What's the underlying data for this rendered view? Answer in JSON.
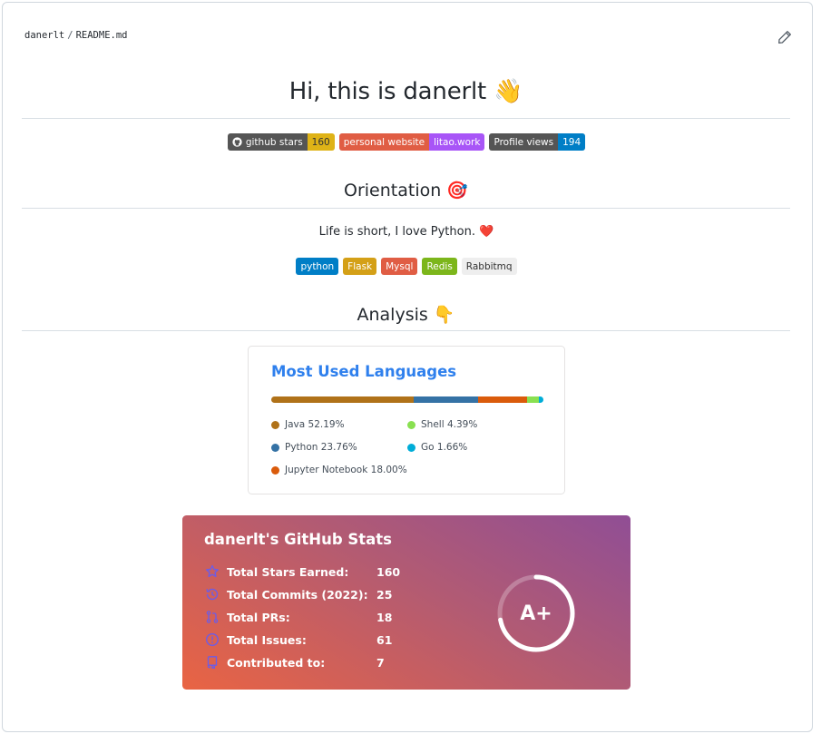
{
  "breadcrumb": {
    "owner": "danerlt",
    "separator": "/",
    "file": "README.md"
  },
  "heading": {
    "text": "Hi, this is danerlt",
    "emoji": "👋"
  },
  "badges": [
    {
      "label": "github stars",
      "value": "160",
      "value_color": "#dfb317"
    },
    {
      "label": "personal website",
      "value": "litao.work",
      "label_color": "#e05d44",
      "value_color": "#a855f7"
    },
    {
      "label": "Profile views",
      "value": "194",
      "value_color": "#007ec6"
    }
  ],
  "orientation": {
    "title": "Orientation",
    "emoji": "🎯",
    "motto": "Life is short, I love Python.",
    "motto_emoji": "❤️",
    "tags": [
      {
        "text": "python",
        "color": "#007ec6",
        "text_color": "#ffffff"
      },
      {
        "text": "Flask",
        "color": "#d4a017",
        "text_color": "#ffffff"
      },
      {
        "text": "Mysql",
        "color": "#e05d44",
        "text_color": "#ffffff"
      },
      {
        "text": "Redis",
        "color": "#7cb61b",
        "text_color": "#ffffff"
      },
      {
        "text": "Rabbitmq",
        "color": "#eeeeee",
        "text_color": "#333333"
      }
    ]
  },
  "analysis": {
    "title": "Analysis",
    "emoji": "👇"
  },
  "languages": {
    "title": "Most Used Languages",
    "items": [
      {
        "name": "Java",
        "percent": 52.19,
        "label": "Java 52.19%",
        "color": "#b07219"
      },
      {
        "name": "Python",
        "percent": 23.76,
        "label": "Python 23.76%",
        "color": "#3572a5"
      },
      {
        "name": "Jupyter Notebook",
        "percent": 18.0,
        "label": "Jupyter Notebook 18.00%",
        "color": "#da5b0b"
      },
      {
        "name": "Shell",
        "percent": 4.39,
        "label": "Shell 4.39%",
        "color": "#89e051"
      },
      {
        "name": "Go",
        "percent": 1.66,
        "label": "Go 1.66%",
        "color": "#00add8"
      }
    ]
  },
  "stats": {
    "title": "danerlt's GitHub Stats",
    "rows": [
      {
        "icon": "star-icon",
        "label": "Total Stars Earned:",
        "value": "160"
      },
      {
        "icon": "history-icon",
        "label": "Total Commits (2022):",
        "value": "25"
      },
      {
        "icon": "pull-request-icon",
        "label": "Total PRs:",
        "value": "18"
      },
      {
        "icon": "issue-icon",
        "label": "Total Issues:",
        "value": "61"
      },
      {
        "icon": "repo-icon",
        "label": "Contributed to:",
        "value": "7"
      }
    ],
    "rank": "A+",
    "rank_progress": 0.72,
    "icon_color": "#6c5ce7"
  }
}
